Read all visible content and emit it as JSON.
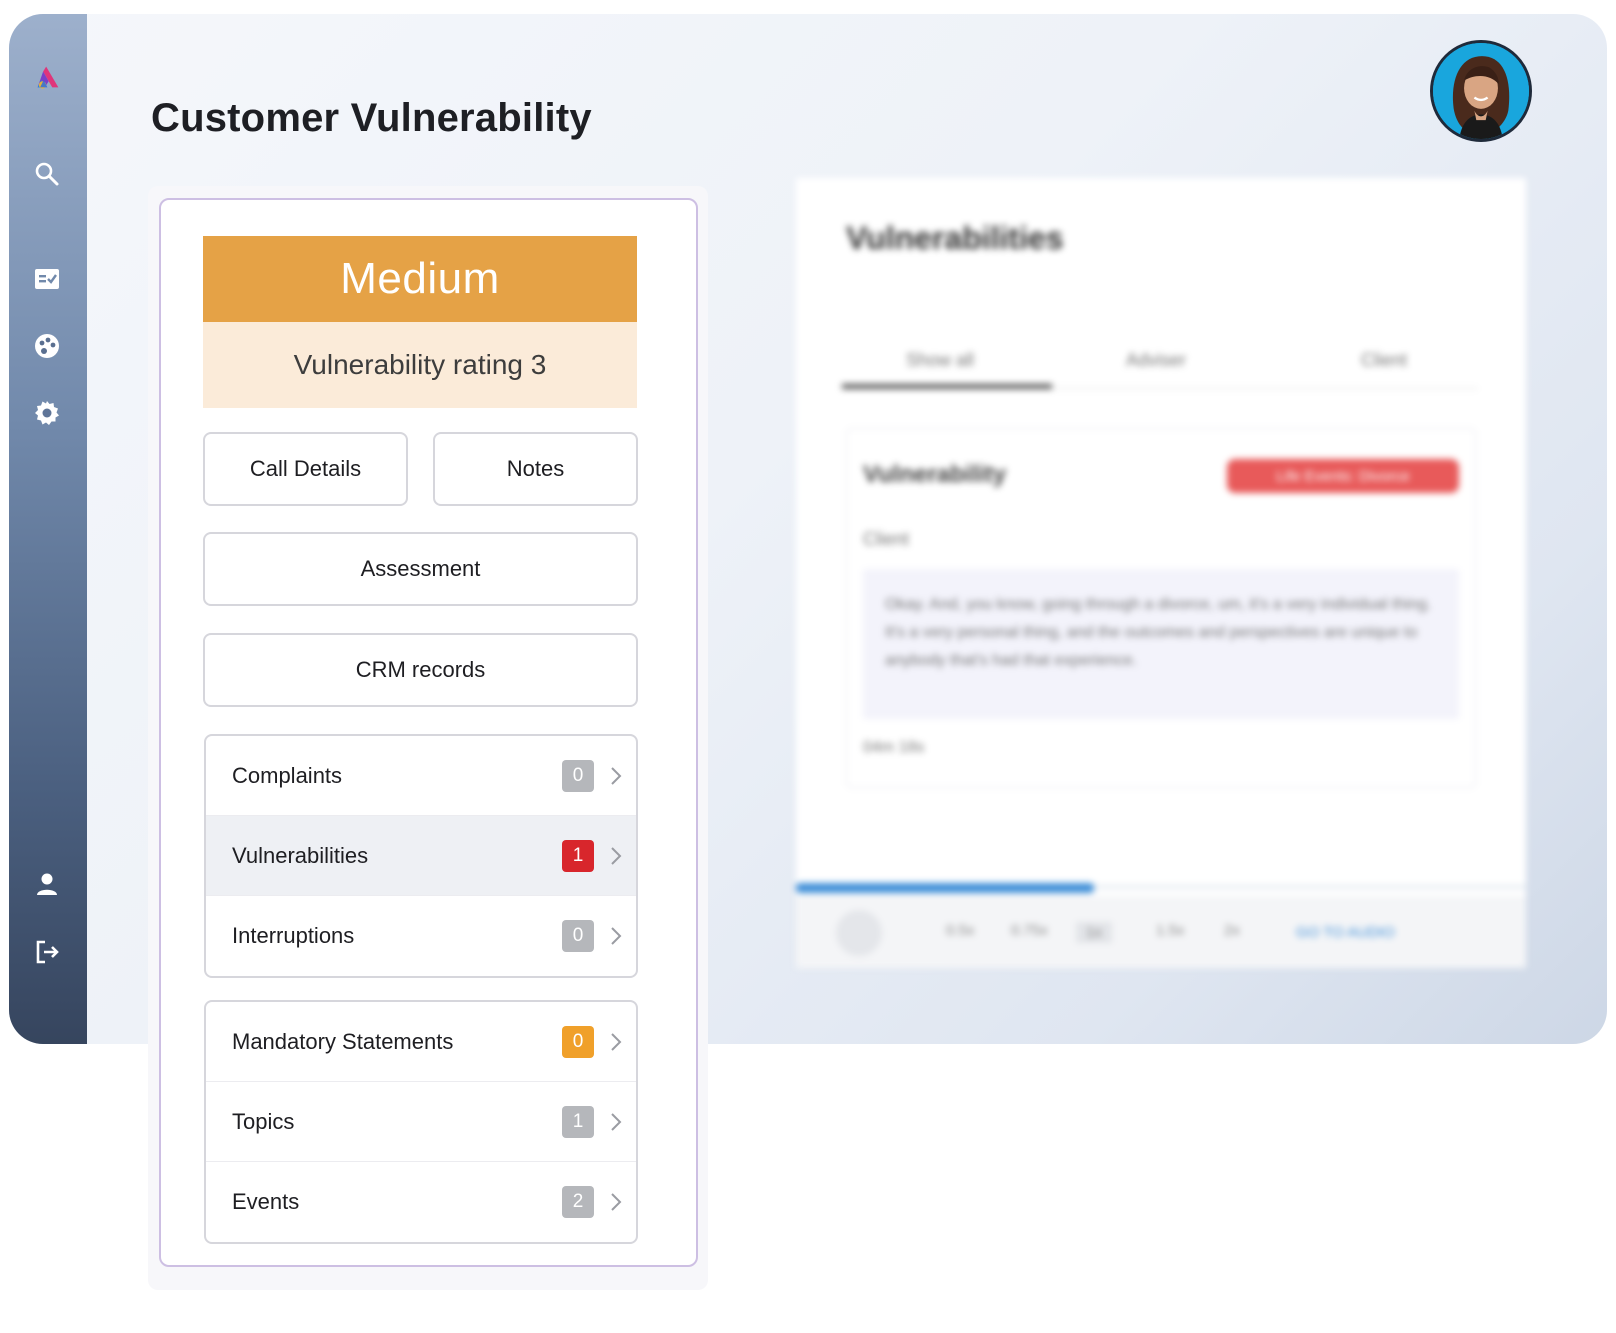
{
  "page": {
    "title": "Customer Vulnerability"
  },
  "sidebar": {
    "icons": [
      "logo-icon",
      "search-icon",
      "checklist-icon",
      "palette-icon",
      "gear-icon",
      "user-icon",
      "logout-icon"
    ]
  },
  "rating": {
    "level": "Medium",
    "label": "Vulnerability rating 3",
    "color": "#e5a246"
  },
  "buttons": {
    "call_details": "Call Details",
    "notes": "Notes",
    "assessment": "Assessment",
    "crm_records": "CRM records"
  },
  "list_primary": [
    {
      "label": "Complaints",
      "count": "0",
      "badge_color": "#b5b7bb"
    },
    {
      "label": "Vulnerabilities",
      "count": "1",
      "badge_color": "#d8262c",
      "active": true
    },
    {
      "label": "Interruptions",
      "count": "0",
      "badge_color": "#b5b7bb"
    }
  ],
  "list_secondary": [
    {
      "label": "Mandatory Statements",
      "count": "0",
      "badge_color": "#f0a02a"
    },
    {
      "label": "Topics",
      "count": "1",
      "badge_color": "#b5b7bb"
    },
    {
      "label": "Events",
      "count": "2",
      "badge_color": "#b5b7bb"
    }
  ],
  "background_panel": {
    "title": "Vulnerabilities",
    "tabs": [
      "Show all",
      "Adviser",
      "Client"
    ],
    "card_title": "Vulnerability",
    "badge": "Life Events: Divorce",
    "speaker": "Client",
    "quote": "Okay. And, you know, going through a divorce, um, it's a very individual thing. It's a very personal thing, and the outcomes and perspectives are unique to anybody that's had that experience.",
    "timestamp": "04m 18s",
    "speeds": [
      "0.5x",
      "0.75x",
      "1x",
      "1.5x",
      "2x"
    ],
    "link": "GO TO AUDIO"
  }
}
